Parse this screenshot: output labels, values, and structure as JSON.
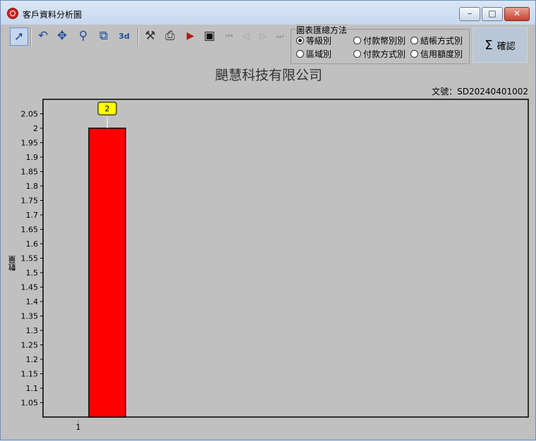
{
  "window": {
    "title": "客戶資料分析圖"
  },
  "toolbar": {
    "icons": [
      "pointer-icon",
      "rotate-icon",
      "pan-icon",
      "zoom-icon",
      "export-icon",
      "3d-icon",
      "tools-icon",
      "print-icon",
      "copy-icon",
      "save-icon",
      "first-page-icon",
      "prev-page-icon",
      "next-page-icon",
      "last-page-icon"
    ]
  },
  "groupbox": {
    "title": "圖表匯總方法",
    "options": [
      "等級別",
      "付款幣別別",
      "結帳方式別",
      "區域別",
      "付款方式別",
      "信用額度別"
    ],
    "selected": "等級別"
  },
  "confirm": {
    "label": "確認"
  },
  "header": {
    "company": "颶慧科技有限公司",
    "doc_label": "文號：",
    "doc_no": "SD20240401002"
  },
  "chart_data": {
    "type": "bar",
    "categories": [
      "1"
    ],
    "values": [
      2
    ],
    "data_labels": [
      "2"
    ],
    "title": "颶慧科技有限公司",
    "xlabel": "",
    "ylabel": "數量",
    "ylim": [
      1.0,
      2.1
    ],
    "yticks": [
      "2.05",
      "2",
      "1.95",
      "1.9",
      "1.85",
      "1.8",
      "1.75",
      "1.7",
      "1.65",
      "1.6",
      "1.55",
      "1.5",
      "1.45",
      "1.4",
      "1.35",
      "1.3",
      "1.25",
      "1.2",
      "1.15",
      "1.1",
      "1.05"
    ],
    "bar_color": "#ff0000",
    "plot_bg": "#c0c0c0",
    "label_bg": "#ffff00",
    "grid": false
  }
}
